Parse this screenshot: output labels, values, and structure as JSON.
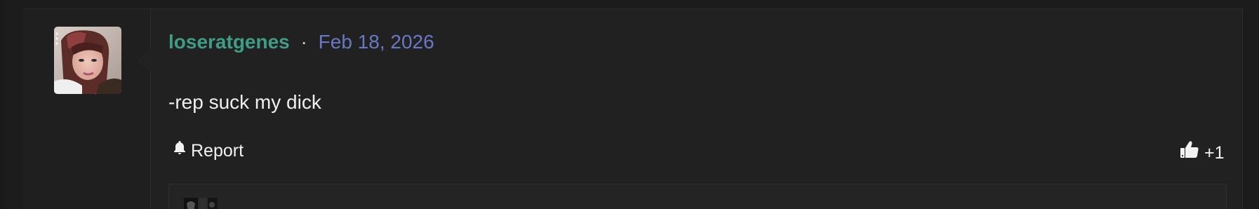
{
  "post": {
    "username": "loseratgenes",
    "separator": "·",
    "date": "Feb 18, 2026",
    "content": "-rep suck my dick",
    "report_label": "Report",
    "like_count": "+1"
  },
  "colors": {
    "username": "#3f9d85",
    "date": "#6a78c4",
    "background": "#1c1c1c",
    "panel": "#212121"
  },
  "icons": {
    "report": "bell-icon",
    "like": "thumbs-up-icon"
  }
}
